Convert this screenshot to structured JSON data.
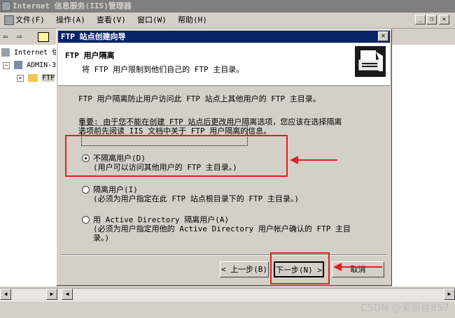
{
  "window": {
    "title": "Internet 信息服务(IIS)管理器"
  },
  "menubar": {
    "items": [
      "文件(F)",
      "操作(A)",
      "查看(V)",
      "窗口(W)",
      "帮助(H)"
    ],
    "mdi_minimize": "_",
    "mdi_restore": "❐",
    "mdi_close": "✕"
  },
  "toolbar": {
    "back": "⇦",
    "forward": "⇨"
  },
  "tree": {
    "root": "Internet 信",
    "server": "ADMIN-3",
    "site": "FTP",
    "expander_minus": "−",
    "expander_plus": "+"
  },
  "dialog": {
    "title": "FTP 站点创建向导",
    "close": "✕",
    "header_title": "FTP 用户隔离",
    "header_subtitle": "将 FTP 用户限制到他们自己的 FTP 主目录。",
    "intro": "FTP 用户隔离防止用户访问此 FTP 站点上其他用户的 FTP 主目录。",
    "warning_line1": "重要: 由于您不能在创建 FTP 站点后更改用户隔离选项，您应该在选择隔离",
    "warning_line2": "选项前先阅读 IIS 文档中关于 FTP 用户隔离的信息。",
    "options": [
      {
        "label": "不隔离用户(D)",
        "desc": "(用户可以访问其他用户的 FTP 主目录。)",
        "selected": true
      },
      {
        "label": "隔离用户(I)",
        "desc": "(必须为用户指定在此 FTP 站点根目录下的 FTP 主目录。)",
        "selected": false
      },
      {
        "label": "用 Active Directory 隔离用户(A)",
        "desc": "(必须为用户指定用他的 Active Directory 用户帐户确认的 FTP 主目",
        "desc2": "录。)",
        "selected": false
      }
    ],
    "buttons": {
      "back": "< 上一步(B)",
      "next": "下一步(N) >",
      "cancel": "取消"
    }
  },
  "statusbar": {
    "watermark": "CSDN @爱丽丝857"
  },
  "scroll": {
    "left": "◀",
    "right": "▶"
  },
  "colors": {
    "accent": "#0a246a",
    "annotation": "#e02020"
  }
}
